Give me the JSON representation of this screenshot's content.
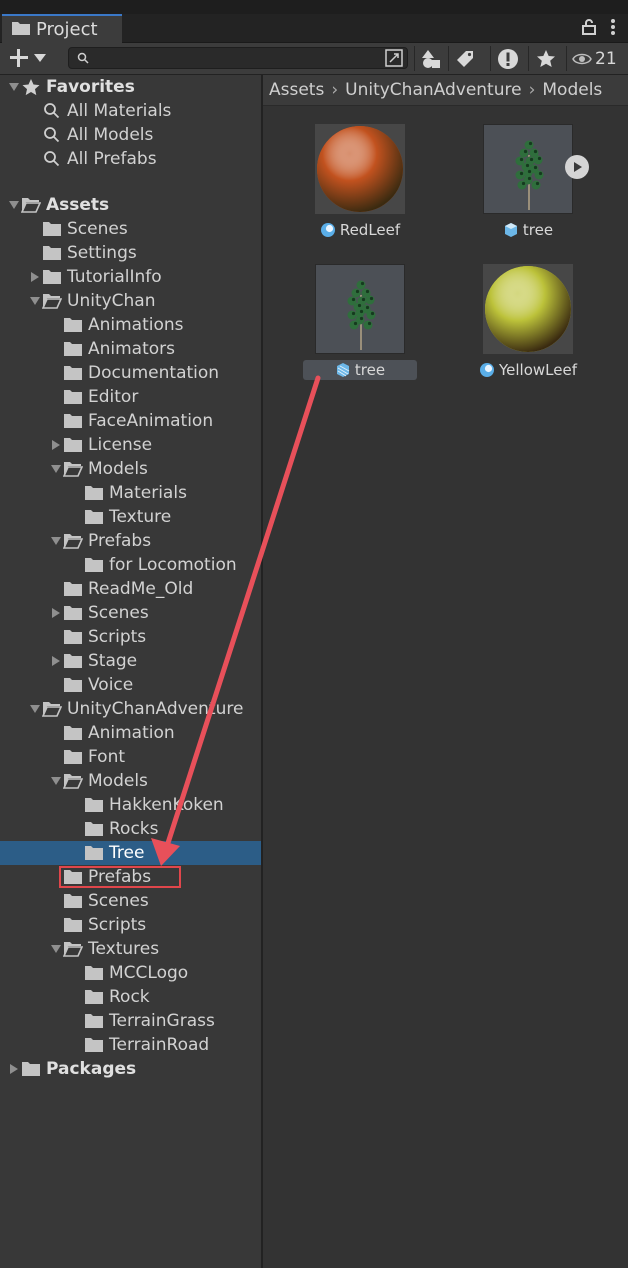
{
  "window": {
    "tab_title": "Project",
    "visible_count": "21"
  },
  "search": {
    "placeholder": ""
  },
  "breadcrumb": [
    "Assets",
    "UnityChanAdventure",
    "Models"
  ],
  "tree": [
    {
      "label": "Favorites",
      "depth": 0,
      "icon": "star-icon",
      "arrow": "expanded",
      "bold": true
    },
    {
      "label": "All Materials",
      "depth": 2,
      "icon": "search-icon",
      "arrow": "none"
    },
    {
      "label": "All Models",
      "depth": 2,
      "icon": "search-icon",
      "arrow": "none"
    },
    {
      "label": "All Prefabs",
      "depth": 2,
      "icon": "search-icon",
      "arrow": "none"
    },
    {
      "label": "",
      "depth": 0,
      "icon": "none",
      "arrow": "none",
      "spacer": true
    },
    {
      "label": "Assets",
      "depth": 0,
      "icon": "folder-open-icon",
      "arrow": "expanded",
      "bold": true
    },
    {
      "label": "Scenes",
      "depth": 2,
      "icon": "folder-icon",
      "arrow": "none"
    },
    {
      "label": "Settings",
      "depth": 2,
      "icon": "folder-icon",
      "arrow": "none"
    },
    {
      "label": "TutorialInfo",
      "depth": 2,
      "icon": "folder-icon",
      "arrow": "collapsed"
    },
    {
      "label": "UnityChan",
      "depth": 2,
      "icon": "folder-open-icon",
      "arrow": "expanded"
    },
    {
      "label": "Animations",
      "depth": 3,
      "icon": "folder-icon",
      "arrow": "none"
    },
    {
      "label": "Animators",
      "depth": 3,
      "icon": "folder-icon",
      "arrow": "none"
    },
    {
      "label": "Documentation",
      "depth": 3,
      "icon": "folder-icon",
      "arrow": "none"
    },
    {
      "label": "Editor",
      "depth": 3,
      "icon": "folder-icon",
      "arrow": "none"
    },
    {
      "label": "FaceAnimation",
      "depth": 3,
      "icon": "folder-icon",
      "arrow": "none"
    },
    {
      "label": "License",
      "depth": 3,
      "icon": "folder-icon",
      "arrow": "collapsed"
    },
    {
      "label": "Models",
      "depth": 3,
      "icon": "folder-open-icon",
      "arrow": "expanded"
    },
    {
      "label": "Materials",
      "depth": 4,
      "icon": "folder-icon",
      "arrow": "none"
    },
    {
      "label": "Texture",
      "depth": 4,
      "icon": "folder-icon",
      "arrow": "none"
    },
    {
      "label": "Prefabs",
      "depth": 3,
      "icon": "folder-open-icon",
      "arrow": "expanded"
    },
    {
      "label": "for Locomotion",
      "depth": 4,
      "icon": "folder-icon",
      "arrow": "none"
    },
    {
      "label": "ReadMe_Old",
      "depth": 3,
      "icon": "folder-icon",
      "arrow": "none"
    },
    {
      "label": "Scenes",
      "depth": 3,
      "icon": "folder-icon",
      "arrow": "collapsed"
    },
    {
      "label": "Scripts",
      "depth": 3,
      "icon": "folder-icon",
      "arrow": "none"
    },
    {
      "label": "Stage",
      "depth": 3,
      "icon": "folder-icon",
      "arrow": "collapsed"
    },
    {
      "label": "Voice",
      "depth": 3,
      "icon": "folder-icon",
      "arrow": "none"
    },
    {
      "label": "UnityChanAdventure",
      "depth": 2,
      "icon": "folder-open-icon",
      "arrow": "expanded"
    },
    {
      "label": "Animation",
      "depth": 3,
      "icon": "folder-icon",
      "arrow": "none"
    },
    {
      "label": "Font",
      "depth": 3,
      "icon": "folder-icon",
      "arrow": "none"
    },
    {
      "label": "Models",
      "depth": 3,
      "icon": "folder-open-icon",
      "arrow": "expanded"
    },
    {
      "label": "HakkenKoken",
      "depth": 4,
      "icon": "folder-icon",
      "arrow": "none"
    },
    {
      "label": "Rocks",
      "depth": 4,
      "icon": "folder-icon",
      "arrow": "none"
    },
    {
      "label": "Tree",
      "depth": 4,
      "icon": "folder-icon",
      "arrow": "none",
      "selected": true
    },
    {
      "label": "Prefabs",
      "depth": 3,
      "icon": "folder-icon",
      "arrow": "none",
      "highlighted": true
    },
    {
      "label": "Scenes",
      "depth": 3,
      "icon": "folder-icon",
      "arrow": "none"
    },
    {
      "label": "Scripts",
      "depth": 3,
      "icon": "folder-icon",
      "arrow": "none"
    },
    {
      "label": "Textures",
      "depth": 3,
      "icon": "folder-open-icon",
      "arrow": "expanded"
    },
    {
      "label": "MCCLogo",
      "depth": 4,
      "icon": "folder-icon",
      "arrow": "none"
    },
    {
      "label": "Rock",
      "depth": 4,
      "icon": "folder-icon",
      "arrow": "none"
    },
    {
      "label": "TerrainGrass",
      "depth": 4,
      "icon": "folder-icon",
      "arrow": "none"
    },
    {
      "label": "TerrainRoad",
      "depth": 4,
      "icon": "folder-icon",
      "arrow": "none"
    },
    {
      "label": "Packages",
      "depth": 0,
      "icon": "folder-icon",
      "arrow": "collapsed",
      "bold": true
    }
  ],
  "assets": [
    {
      "label": "RedLeef",
      "kind": "material",
      "icon": "material-icon",
      "color": "#c2521f"
    },
    {
      "label": "tree",
      "kind": "model",
      "icon": "model-icon",
      "has_play": true
    },
    {
      "label": "tree",
      "kind": "prefab",
      "icon": "prefab-icon",
      "selected": true
    },
    {
      "label": "YellowLeef",
      "kind": "material",
      "icon": "material-icon",
      "color": "#bcc23a"
    }
  ],
  "colors": {
    "selection": "#2c5d87",
    "annotation": "#e8505a",
    "tab_accent": "#3a78c8"
  }
}
